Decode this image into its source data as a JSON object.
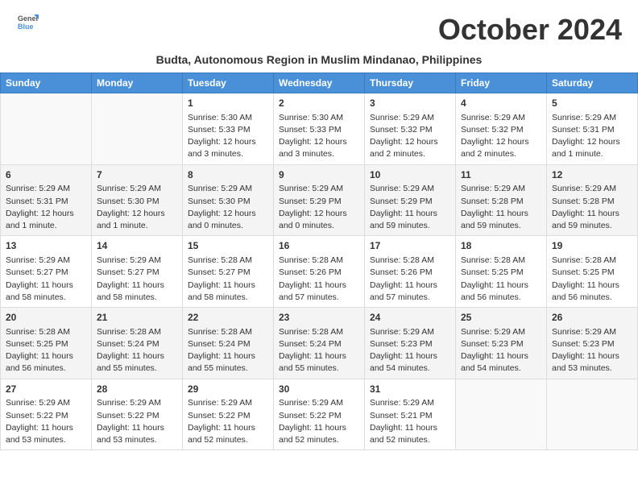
{
  "header": {
    "logo_line1": "General",
    "logo_line2": "Blue",
    "month_title": "October 2024",
    "subtitle": "Budta, Autonomous Region in Muslim Mindanao, Philippines"
  },
  "days_of_week": [
    "Sunday",
    "Monday",
    "Tuesday",
    "Wednesday",
    "Thursday",
    "Friday",
    "Saturday"
  ],
  "weeks": [
    {
      "shaded": false,
      "days": [
        {
          "num": "",
          "info": ""
        },
        {
          "num": "",
          "info": ""
        },
        {
          "num": "1",
          "info": "Sunrise: 5:30 AM\nSunset: 5:33 PM\nDaylight: 12 hours and 3 minutes."
        },
        {
          "num": "2",
          "info": "Sunrise: 5:30 AM\nSunset: 5:33 PM\nDaylight: 12 hours and 3 minutes."
        },
        {
          "num": "3",
          "info": "Sunrise: 5:29 AM\nSunset: 5:32 PM\nDaylight: 12 hours and 2 minutes."
        },
        {
          "num": "4",
          "info": "Sunrise: 5:29 AM\nSunset: 5:32 PM\nDaylight: 12 hours and 2 minutes."
        },
        {
          "num": "5",
          "info": "Sunrise: 5:29 AM\nSunset: 5:31 PM\nDaylight: 12 hours and 1 minute."
        }
      ]
    },
    {
      "shaded": true,
      "days": [
        {
          "num": "6",
          "info": "Sunrise: 5:29 AM\nSunset: 5:31 PM\nDaylight: 12 hours and 1 minute."
        },
        {
          "num": "7",
          "info": "Sunrise: 5:29 AM\nSunset: 5:30 PM\nDaylight: 12 hours and 1 minute."
        },
        {
          "num": "8",
          "info": "Sunrise: 5:29 AM\nSunset: 5:30 PM\nDaylight: 12 hours and 0 minutes."
        },
        {
          "num": "9",
          "info": "Sunrise: 5:29 AM\nSunset: 5:29 PM\nDaylight: 12 hours and 0 minutes."
        },
        {
          "num": "10",
          "info": "Sunrise: 5:29 AM\nSunset: 5:29 PM\nDaylight: 11 hours and 59 minutes."
        },
        {
          "num": "11",
          "info": "Sunrise: 5:29 AM\nSunset: 5:28 PM\nDaylight: 11 hours and 59 minutes."
        },
        {
          "num": "12",
          "info": "Sunrise: 5:29 AM\nSunset: 5:28 PM\nDaylight: 11 hours and 59 minutes."
        }
      ]
    },
    {
      "shaded": false,
      "days": [
        {
          "num": "13",
          "info": "Sunrise: 5:29 AM\nSunset: 5:27 PM\nDaylight: 11 hours and 58 minutes."
        },
        {
          "num": "14",
          "info": "Sunrise: 5:29 AM\nSunset: 5:27 PM\nDaylight: 11 hours and 58 minutes."
        },
        {
          "num": "15",
          "info": "Sunrise: 5:28 AM\nSunset: 5:27 PM\nDaylight: 11 hours and 58 minutes."
        },
        {
          "num": "16",
          "info": "Sunrise: 5:28 AM\nSunset: 5:26 PM\nDaylight: 11 hours and 57 minutes."
        },
        {
          "num": "17",
          "info": "Sunrise: 5:28 AM\nSunset: 5:26 PM\nDaylight: 11 hours and 57 minutes."
        },
        {
          "num": "18",
          "info": "Sunrise: 5:28 AM\nSunset: 5:25 PM\nDaylight: 11 hours and 56 minutes."
        },
        {
          "num": "19",
          "info": "Sunrise: 5:28 AM\nSunset: 5:25 PM\nDaylight: 11 hours and 56 minutes."
        }
      ]
    },
    {
      "shaded": true,
      "days": [
        {
          "num": "20",
          "info": "Sunrise: 5:28 AM\nSunset: 5:25 PM\nDaylight: 11 hours and 56 minutes."
        },
        {
          "num": "21",
          "info": "Sunrise: 5:28 AM\nSunset: 5:24 PM\nDaylight: 11 hours and 55 minutes."
        },
        {
          "num": "22",
          "info": "Sunrise: 5:28 AM\nSunset: 5:24 PM\nDaylight: 11 hours and 55 minutes."
        },
        {
          "num": "23",
          "info": "Sunrise: 5:28 AM\nSunset: 5:24 PM\nDaylight: 11 hours and 55 minutes."
        },
        {
          "num": "24",
          "info": "Sunrise: 5:29 AM\nSunset: 5:23 PM\nDaylight: 11 hours and 54 minutes."
        },
        {
          "num": "25",
          "info": "Sunrise: 5:29 AM\nSunset: 5:23 PM\nDaylight: 11 hours and 54 minutes."
        },
        {
          "num": "26",
          "info": "Sunrise: 5:29 AM\nSunset: 5:23 PM\nDaylight: 11 hours and 53 minutes."
        }
      ]
    },
    {
      "shaded": false,
      "days": [
        {
          "num": "27",
          "info": "Sunrise: 5:29 AM\nSunset: 5:22 PM\nDaylight: 11 hours and 53 minutes."
        },
        {
          "num": "28",
          "info": "Sunrise: 5:29 AM\nSunset: 5:22 PM\nDaylight: 11 hours and 53 minutes."
        },
        {
          "num": "29",
          "info": "Sunrise: 5:29 AM\nSunset: 5:22 PM\nDaylight: 11 hours and 52 minutes."
        },
        {
          "num": "30",
          "info": "Sunrise: 5:29 AM\nSunset: 5:22 PM\nDaylight: 11 hours and 52 minutes."
        },
        {
          "num": "31",
          "info": "Sunrise: 5:29 AM\nSunset: 5:21 PM\nDaylight: 11 hours and 52 minutes."
        },
        {
          "num": "",
          "info": ""
        },
        {
          "num": "",
          "info": ""
        }
      ]
    }
  ]
}
